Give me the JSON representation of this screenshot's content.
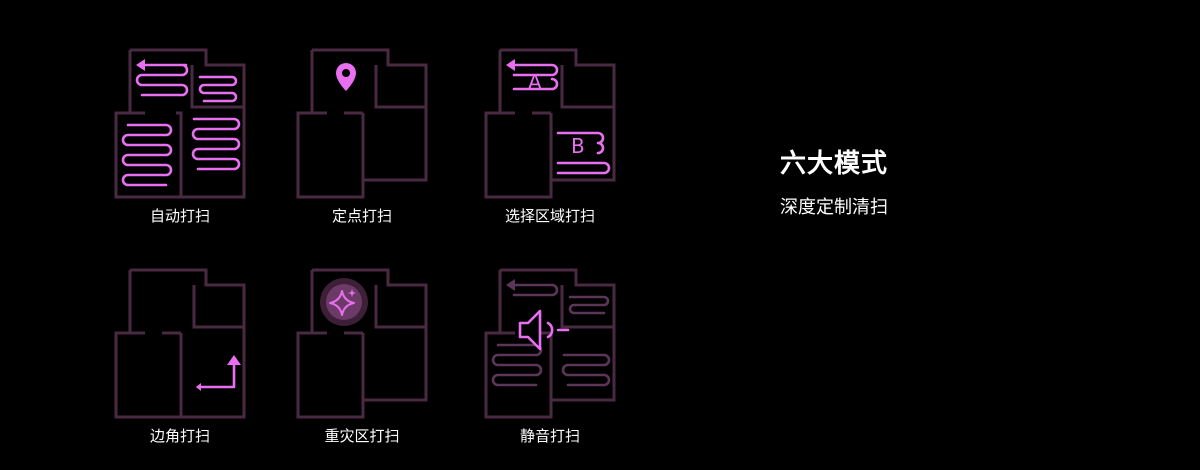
{
  "heading": "六大模式",
  "subheading": "深度定制清扫",
  "modes": [
    {
      "label": "自动打扫",
      "icon": "auto-clean-icon"
    },
    {
      "label": "定点打扫",
      "icon": "spot-clean-icon"
    },
    {
      "label": "选择区域打扫",
      "icon": "zone-clean-icon",
      "zone_letters": [
        "A",
        "B"
      ]
    },
    {
      "label": "边角打扫",
      "icon": "corner-clean-icon"
    },
    {
      "label": "重灾区打扫",
      "icon": "deep-clean-icon"
    },
    {
      "label": "静音打扫",
      "icon": "quiet-clean-icon"
    }
  ],
  "colors": {
    "background": "#000000",
    "floorplan_stroke": "#4a2a42",
    "accent": "#e86ff0",
    "dim_path": "#5d3558",
    "text": "#ffffff"
  }
}
